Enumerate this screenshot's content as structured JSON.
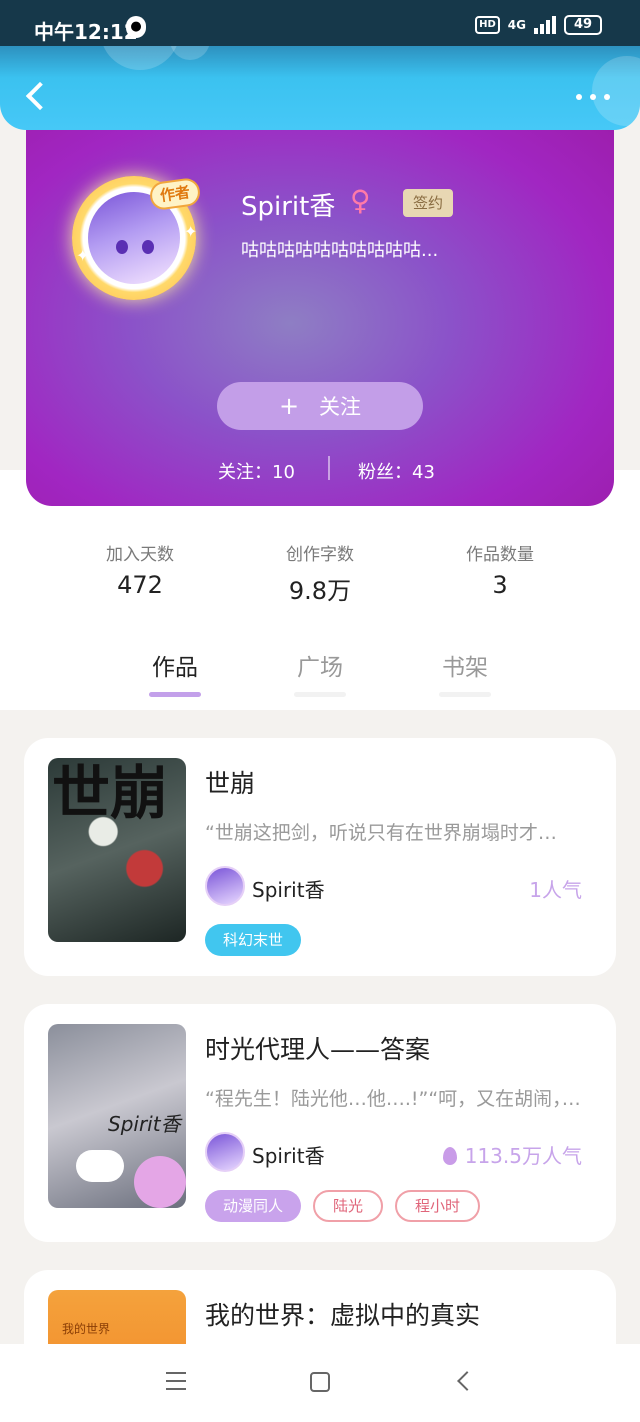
{
  "status_bar": {
    "time": "中午12:12",
    "hd": "HD",
    "network": "4G",
    "battery": "49"
  },
  "header": {
    "back_icon": "chevron-left-icon",
    "more_icon": "more-dots-icon"
  },
  "profile": {
    "avatar_badge": "作者",
    "username": "Spirit香",
    "gender_symbol": "♀",
    "signed_badge": "签约",
    "bio": "咕咕咕咕咕咕咕咕咕咕...",
    "follow_button": {
      "icon": "+",
      "label": "关注"
    },
    "following": "关注：10",
    "followers": "粉丝：43"
  },
  "stats": [
    {
      "label": "加入天数",
      "value": "472"
    },
    {
      "label": "创作字数",
      "value": "9.8万"
    },
    {
      "label": "作品数量",
      "value": "3"
    }
  ],
  "tabs": [
    {
      "label": "作品",
      "active": true
    },
    {
      "label": "广场",
      "active": false
    },
    {
      "label": "书架",
      "active": false
    }
  ],
  "works": [
    {
      "cover_text": "世崩",
      "title": "世崩",
      "desc": "“世崩这把剑，听说只有在世界崩塌时才…",
      "author": "Spirit香",
      "popularity": "1人气",
      "tags": [
        "科幻末世"
      ]
    },
    {
      "cover_text": "Spirit香",
      "title": "时光代理人——答案",
      "desc": "“程先生！陆光他…他….!”“呵，又在胡闹，”…",
      "author": "Spirit香",
      "popularity": "113.5万人气",
      "tags": [
        "动漫同人",
        "陆光",
        "程小时"
      ]
    },
    {
      "cover_text": "我的世界",
      "title": "我的世界：虚拟中的真实"
    }
  ],
  "colors": {
    "accent": "#c3a0ea",
    "header": "#3bc2f0",
    "tag_cyan": "#41c6ef",
    "tag_outline": "#e0657a"
  }
}
